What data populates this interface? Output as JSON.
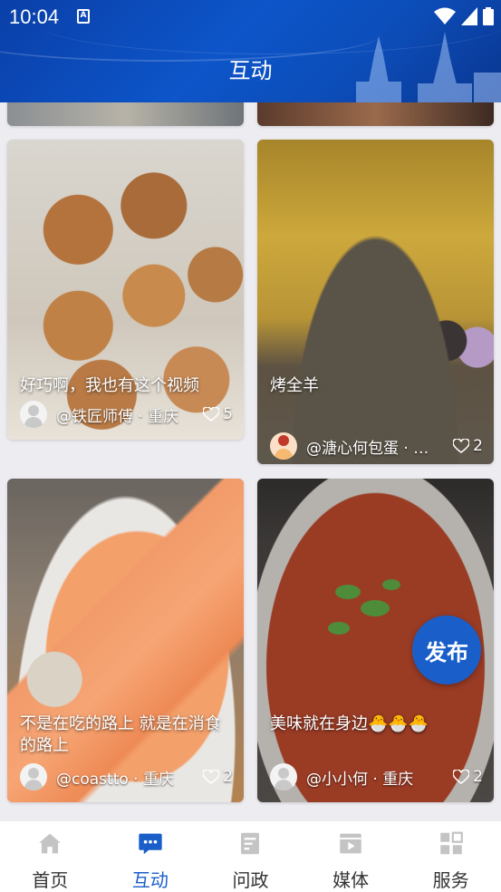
{
  "status_bar": {
    "time": "10:04"
  },
  "header": {
    "title": "互动"
  },
  "posts": [
    {
      "caption": "好巧啊，我也有这个视频",
      "author": "@铁匠师傅",
      "location": "重庆",
      "likes": "5"
    },
    {
      "caption": "烤全羊",
      "author": "@溏心何包蛋 · …",
      "location": "",
      "likes": "2"
    },
    {
      "caption": "不是在吃的路上 就是在消食的路上",
      "author": "@coastto",
      "location": "重庆",
      "likes": "2"
    },
    {
      "caption": "美味就在身边🐣🐣🐣",
      "author": "@小小何",
      "location": "重庆",
      "likes": "2"
    }
  ],
  "fab": {
    "label": "发布"
  },
  "nav": {
    "items": [
      {
        "label": "首页",
        "icon": "home-icon"
      },
      {
        "label": "互动",
        "icon": "chat-icon"
      },
      {
        "label": "问政",
        "icon": "document-icon"
      },
      {
        "label": "媒体",
        "icon": "video-icon"
      },
      {
        "label": "服务",
        "icon": "grid-icon"
      }
    ],
    "active": "互动"
  },
  "colors": {
    "brand": "#1a5fc9",
    "header": "#0d55c9"
  }
}
